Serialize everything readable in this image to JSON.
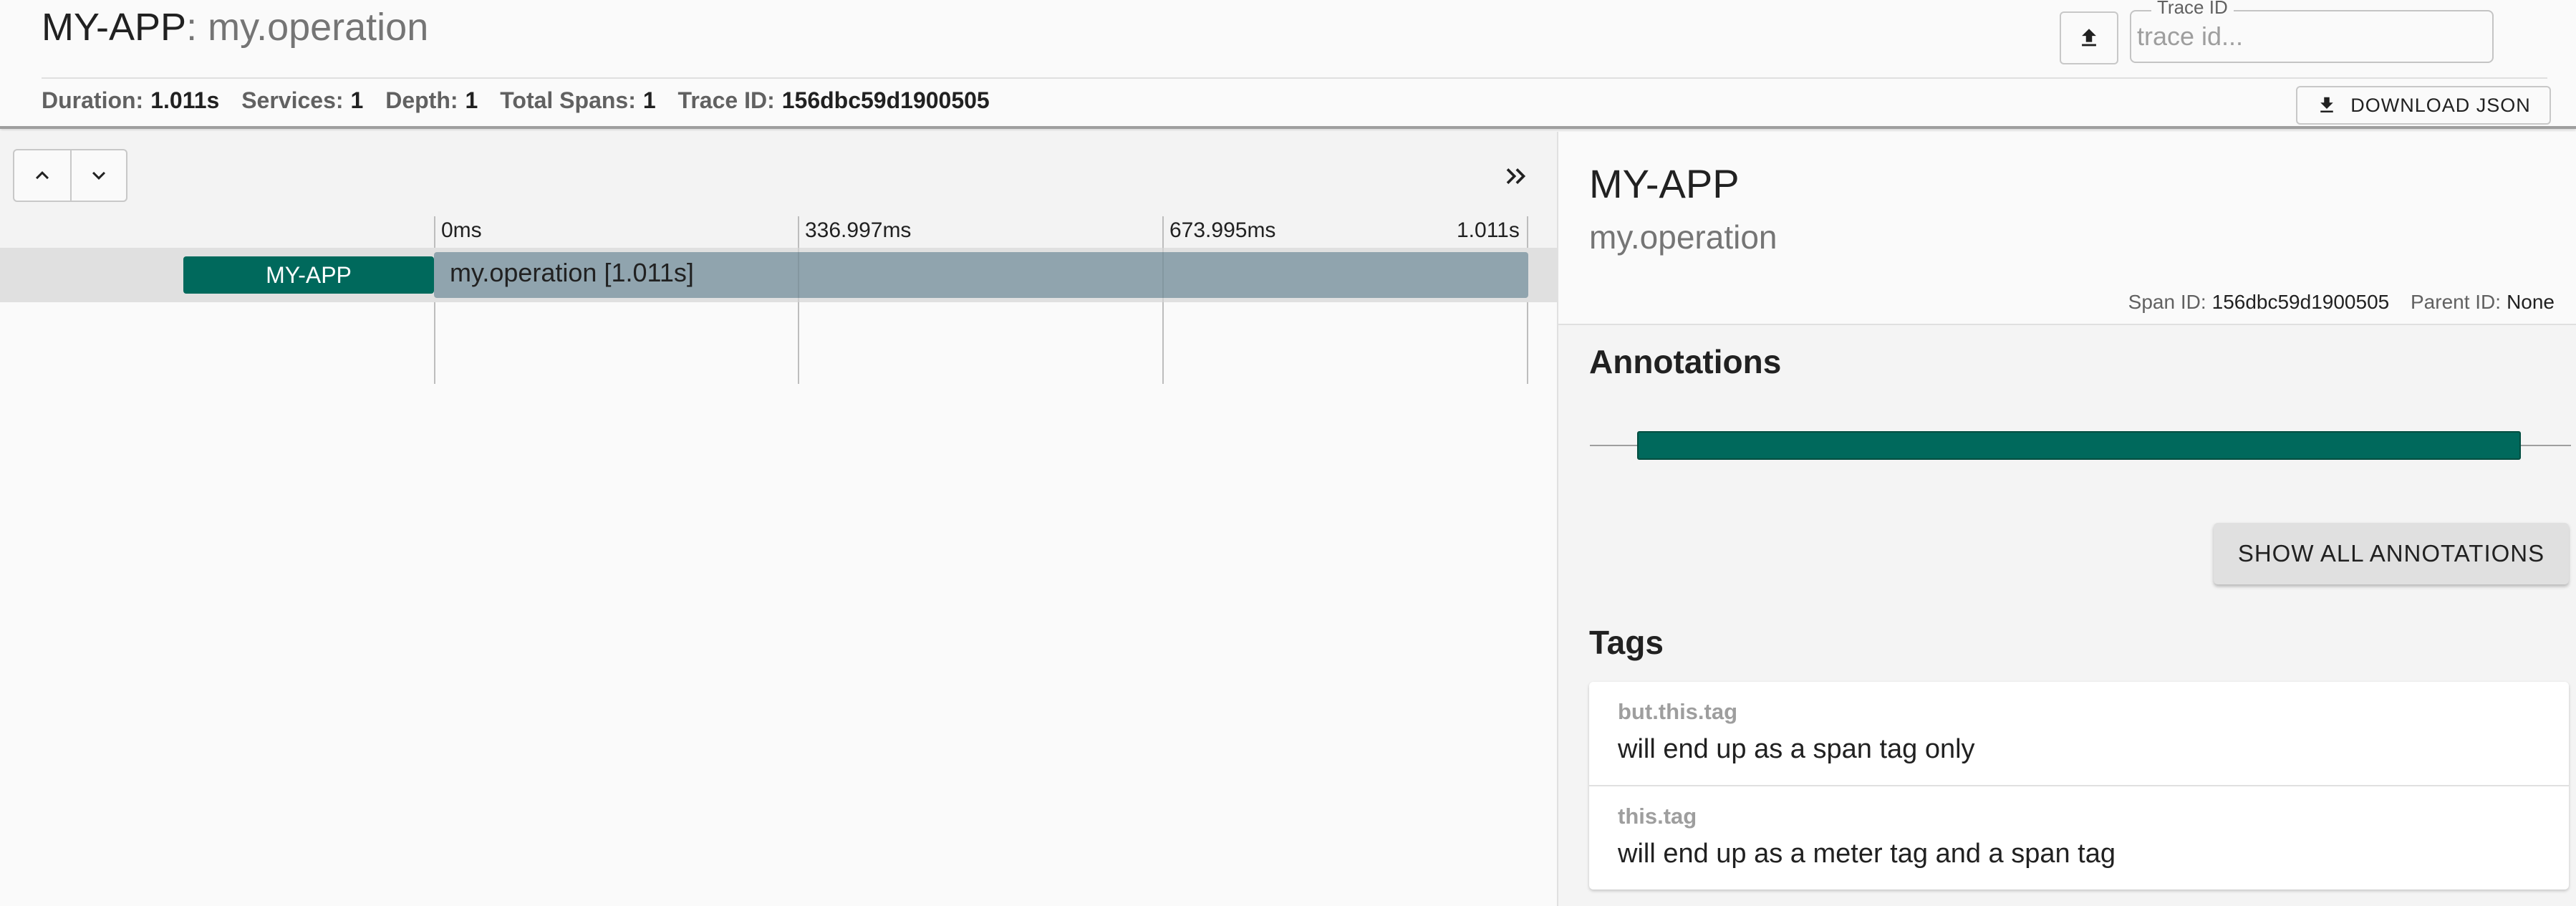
{
  "header": {
    "service_name": "MY-APP",
    "separator": ": ",
    "operation_name": "my.operation",
    "summary": [
      {
        "label": "Duration:",
        "value": "1.011s"
      },
      {
        "label": "Services:",
        "value": "1"
      },
      {
        "label": "Depth:",
        "value": "1"
      },
      {
        "label": "Total Spans:",
        "value": "1"
      },
      {
        "label": "Trace ID:",
        "value": "156dbc59d1900505"
      }
    ],
    "trace_id_label": "Trace ID",
    "trace_id_placeholder": "trace id...",
    "upload_icon": "upload-icon",
    "download_label": "DOWNLOAD JSON",
    "download_icon": "download-icon"
  },
  "timeline": {
    "nav_up_icon": "chevron-up-icon",
    "nav_down_icon": "chevron-down-icon",
    "expand_icon": "double-chevron-right-icon",
    "ticks": [
      "0ms",
      "336.997ms",
      "673.995ms",
      "1.011s"
    ],
    "spans": [
      {
        "service": "MY-APP",
        "label": "my.operation [1.011s]"
      }
    ],
    "colors": {
      "service_badge": "#00695c",
      "span_bar": "#90a4ae"
    }
  },
  "detail": {
    "service_name": "MY-APP",
    "operation_name": "my.operation",
    "span_id_label": "Span ID:",
    "span_id": "156dbc59d1900505",
    "parent_id_label": "Parent ID:",
    "parent_id": "None",
    "annotations_title": "Annotations",
    "show_all_label": "SHOW ALL ANNOTATIONS",
    "tags_title": "Tags",
    "tags": [
      {
        "key": "but.this.tag",
        "value": "will end up as a span tag only"
      },
      {
        "key": "this.tag",
        "value": "will end up as a meter tag and a span tag"
      }
    ]
  }
}
